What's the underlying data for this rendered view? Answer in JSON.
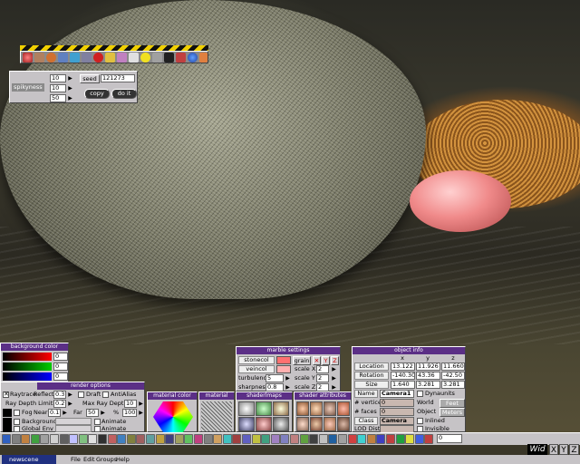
{
  "scene": {
    "description_colors": {
      "rock": "#8a8a74",
      "ball": "#f08a8a",
      "sponge": "#c0853a",
      "water": "#2c2a22"
    }
  },
  "spiky": {
    "label": "spikyness",
    "v1": "10",
    "v2": "10",
    "v3": "50",
    "seed_label": "seed",
    "seed_value": "121273",
    "copy": "copy",
    "doit": "do it"
  },
  "bgcolor": {
    "title": "background color",
    "r": "0",
    "g": "0",
    "b": "0",
    "colors": [
      "#ff0000",
      "#00cc00",
      "#0000ff"
    ]
  },
  "render": {
    "title": "render options",
    "raytrace": "Raytrace",
    "reflect_label": "Reflect:",
    "reflect": "0.3",
    "draft": "Draft",
    "antialias": "AntiAlias",
    "raydepth_label": "Ray Depth Limiting",
    "raydepth": "0.2",
    "maxray_label": "Max Ray Depth:",
    "maxray": "10",
    "fog": "Fog",
    "near_label": "Near",
    "near": "0.1",
    "far_label": "Far",
    "far": "50",
    "pct_label": "%",
    "pct": "100",
    "background": "Background",
    "animate1": "Animate",
    "globalenv": "Global Env",
    "animate2": "Animate"
  },
  "material_color": {
    "title": "material color"
  },
  "material": {
    "title": "material"
  },
  "shaders": {
    "title": "shaderlmaps"
  },
  "shader_attr": {
    "title": "shader attributes"
  },
  "marble": {
    "title": "marble settings",
    "stonecol": "stonecol",
    "grain": "grain",
    "veincol": "veincol",
    "turbulence_label": "turbulence",
    "turbulence": "5",
    "sharpness_label": "sharpness",
    "sharpness": "0.8",
    "scalex_label": "scale X",
    "scalex": "2",
    "scaley_label": "scale Y",
    "scaley": "2",
    "scalez_label": "scale Z",
    "scalez": "2"
  },
  "objinfo": {
    "title": "object info",
    "hx": "x",
    "hy": "y",
    "hz": "z",
    "rows": [
      {
        "label": "Location",
        "x": "13.122",
        "y": "11.926",
        "z": "11.660"
      },
      {
        "label": "Rotation",
        "x": "-140.30",
        "y": "43.36",
        "z": "-42.50"
      },
      {
        "label": "Size",
        "x": "1.640",
        "y": "3.281",
        "z": "3.281"
      }
    ],
    "name_label": "Name",
    "name": "Camera1",
    "dynaunits": "Dynaunits",
    "vertices_label": "# vertices",
    "vertices": "0",
    "world": "World",
    "feet": "Feet",
    "faces_label": "# faces",
    "faces": "0",
    "object": "Object",
    "meters": "Meters",
    "class_label": "Class",
    "class": "Camera",
    "inlined": "Inlined",
    "lod": "LOD Dist",
    "invisible": "Invisible"
  },
  "toolbar": {
    "frame": "0"
  },
  "menu": {
    "newscene": "newscene",
    "file": "File",
    "edit": "Edit",
    "groups": "Groups",
    "help": "Help",
    "brand": "Wid",
    "x": "X",
    "y": "Y",
    "z": "Z"
  }
}
